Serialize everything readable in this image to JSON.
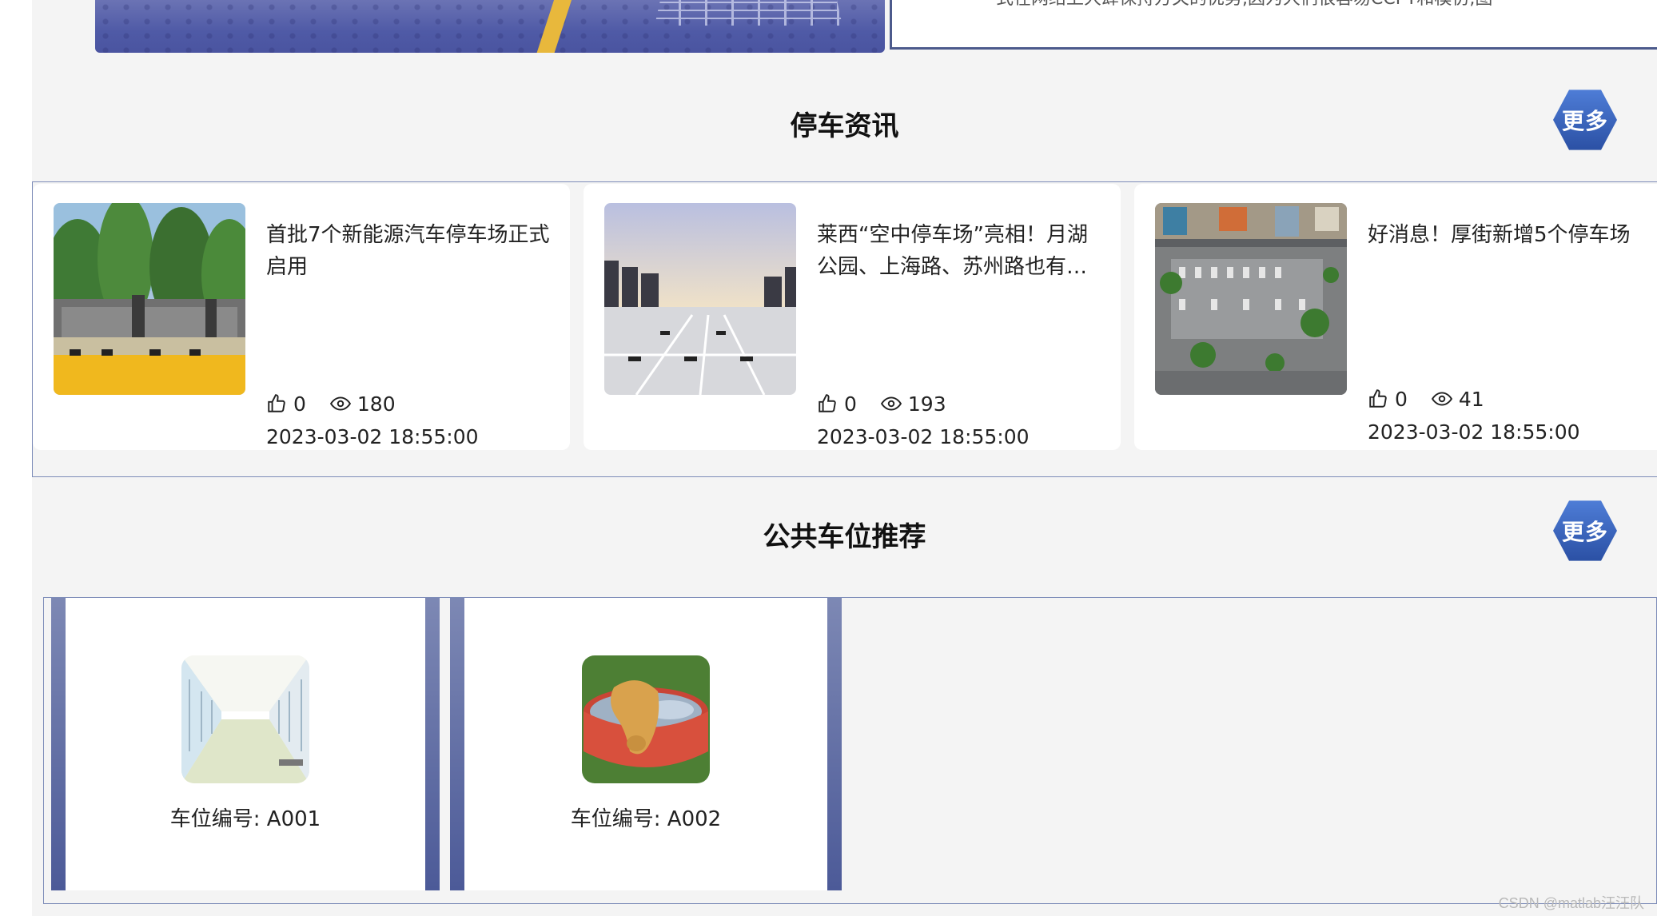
{
  "intro": {
    "snippet": "   式在网络上大肆保持方关的优势,因为大们很容易CCPT和模仿,图"
  },
  "news_section": {
    "title": "停车资讯",
    "more_label": "更多",
    "cards": [
      {
        "title": "首批7个新能源汽车停车场正式启用",
        "likes": "0",
        "views": "180",
        "date": "2023-03-02 18:55:00"
      },
      {
        "title": "莱西“空中停车场”亮相！月湖公园、上海路、苏州路也有新停车场",
        "likes": "0",
        "views": "193",
        "date": "2023-03-02 18:55:00"
      },
      {
        "title": "好消息！厚街新增5个停车场",
        "likes": "0",
        "views": "41",
        "date": "2023-03-02 18:55:00"
      }
    ]
  },
  "lots_section": {
    "title": "公共车位推荐",
    "more_label": "更多",
    "cards": [
      {
        "label": "车位编号: A001"
      },
      {
        "label": "车位编号: A002"
      }
    ]
  },
  "colors": {
    "accent": "#2a4fa3",
    "border": "#7d8cb8",
    "card_frame": "#4c5a98"
  },
  "watermark": "CSDN @matlab汪汪队"
}
